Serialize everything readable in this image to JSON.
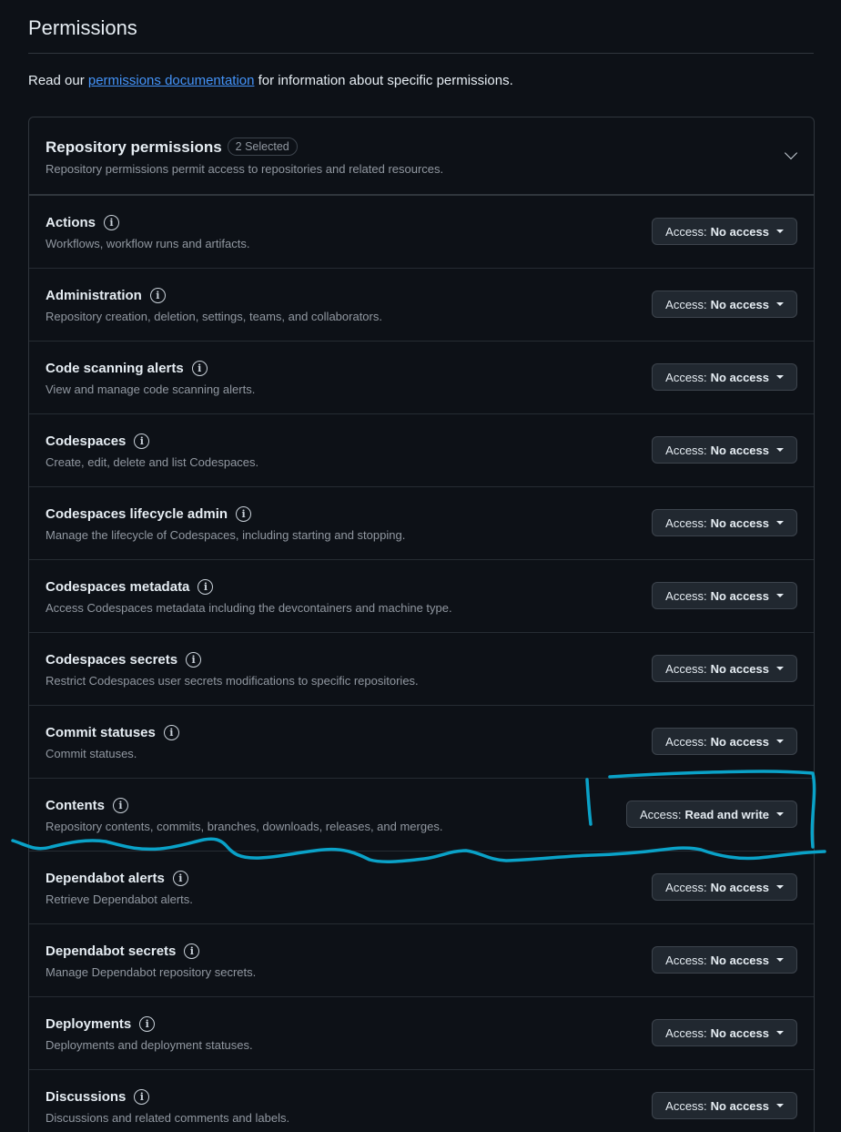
{
  "page": {
    "title": "Permissions",
    "intro_before": "Read our ",
    "intro_link": "permissions documentation",
    "intro_after": " for information about specific permissions."
  },
  "repo_permissions": {
    "title": "Repository permissions",
    "badge": "2 Selected",
    "description": "Repository permissions permit access to repositories and related resources.",
    "access_prefix": "Access: ",
    "rows": [
      {
        "name": "Actions",
        "desc": "Workflows, workflow runs and artifacts.",
        "access": "No access"
      },
      {
        "name": "Administration",
        "desc": "Repository creation, deletion, settings, teams, and collaborators.",
        "access": "No access"
      },
      {
        "name": "Code scanning alerts",
        "desc": "View and manage code scanning alerts.",
        "access": "No access"
      },
      {
        "name": "Codespaces",
        "desc": "Create, edit, delete and list Codespaces.",
        "access": "No access"
      },
      {
        "name": "Codespaces lifecycle admin",
        "desc": "Manage the lifecycle of Codespaces, including starting and stopping.",
        "access": "No access"
      },
      {
        "name": "Codespaces metadata",
        "desc": "Access Codespaces metadata including the devcontainers and machine type.",
        "access": "No access"
      },
      {
        "name": "Codespaces secrets",
        "desc": "Restrict Codespaces user secrets modifications to specific repositories.",
        "access": "No access"
      },
      {
        "name": "Commit statuses",
        "desc": "Commit statuses.",
        "access": "No access"
      },
      {
        "name": "Contents",
        "desc": "Repository contents, commits, branches, downloads, releases, and merges.",
        "access": "Read and write"
      },
      {
        "name": "Dependabot alerts",
        "desc": "Retrieve Dependabot alerts.",
        "access": "No access"
      },
      {
        "name": "Dependabot secrets",
        "desc": "Manage Dependabot repository secrets.",
        "access": "No access"
      },
      {
        "name": "Deployments",
        "desc": "Deployments and deployment statuses.",
        "access": "No access"
      },
      {
        "name": "Discussions",
        "desc": "Discussions and related comments and labels.",
        "access": "No access"
      }
    ]
  },
  "colors": {
    "background": "#0d1117",
    "link": "#4493f8",
    "annotation_stroke": "#0aa2c8"
  },
  "icons": {
    "info": "info-icon",
    "chevron": "chevron-down-icon",
    "caret": "caret-down-icon"
  }
}
